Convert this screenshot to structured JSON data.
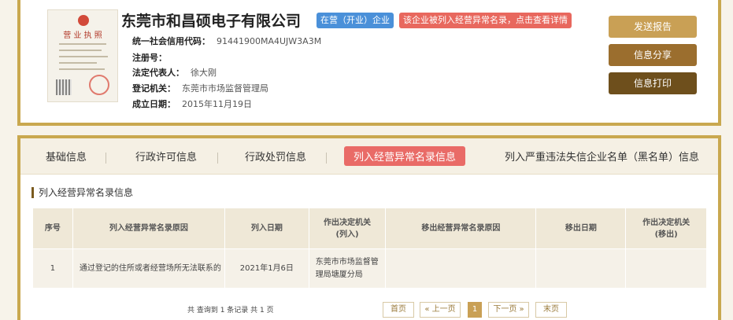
{
  "company": {
    "name": "东莞市和昌硕电子有限公司",
    "status_badge": "在营（开业）企业",
    "warning_badge": "该企业被列入经营异常名录，点击查看详情",
    "license_title": "营 业 执 照"
  },
  "info": [
    {
      "key": "统一社会信用代码：",
      "value": "91441900MA4UJW3A3M"
    },
    {
      "key": "注册号：",
      "value": ""
    },
    {
      "key": "法定代表人：",
      "value": "徐大刚"
    },
    {
      "key": "登记机关：",
      "value": "东莞市市场监督管理局"
    },
    {
      "key": "成立日期：",
      "value": "2015年11月19日"
    }
  ],
  "actions": {
    "report": "发送报告",
    "share": "信息分享",
    "print": "信息打印"
  },
  "tabs": [
    {
      "label": "基础信息"
    },
    {
      "label": "行政许可信息"
    },
    {
      "label": "行政处罚信息"
    },
    {
      "label": "列入经营异常名录信息"
    },
    {
      "label": "列入严重违法失信企业名单（黑名单）信息"
    }
  ],
  "section": {
    "title": "列入经营异常名录信息"
  },
  "table": {
    "headers": [
      "序号",
      "列入经营异常名录原因",
      "列入日期",
      "作出决定机关\n(列入)",
      "移出经营异常名录原因",
      "移出日期",
      "作出决定机关\n(移出)"
    ],
    "rows": [
      {
        "no": "1",
        "reason": "通过登记的住所或者经营场所无法联系的",
        "date": "2021年1月6日",
        "authority": "东莞市市场监督管理局塘厦分局",
        "remove_reason": "",
        "remove_date": "",
        "remove_authority": ""
      }
    ]
  },
  "pager": {
    "summary": "共 查询到 1 条记录 共 1 页",
    "first": "首页",
    "prev": "« 上一页",
    "current": "1",
    "next": "下一页 »",
    "last": "末页"
  },
  "colors": {
    "border": "#c9a84f",
    "status_blue": "#4a90d9",
    "warning_red": "#e8685e",
    "active_tab": "#e96b67",
    "btn_report": "#c9a055",
    "btn_share": "#9b6e2e",
    "btn_print": "#6e4f1c"
  }
}
